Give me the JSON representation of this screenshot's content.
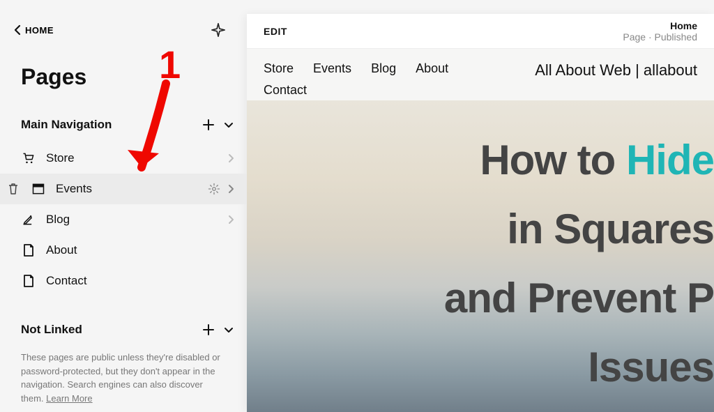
{
  "sidebar": {
    "back_label": "HOME",
    "title": "Pages",
    "main_nav": {
      "title": "Main Navigation",
      "items": [
        {
          "label": "Store"
        },
        {
          "label": "Events"
        },
        {
          "label": "Blog"
        },
        {
          "label": "About"
        },
        {
          "label": "Contact"
        }
      ]
    },
    "not_linked": {
      "title": "Not Linked",
      "desc_prefix": "These pages are public unless they're disabled or password-protected, but they don't appear in the navigation. Search engines can also discover them. ",
      "learn_more": "Learn More"
    }
  },
  "preview": {
    "edit_label": "EDIT",
    "page_name": "Home",
    "page_meta": "Page · Published",
    "site_nav": [
      "Store",
      "Events",
      "Blog",
      "About",
      "Contact"
    ],
    "site_title": "All About Web | allabout",
    "hero_line1_a": "How to ",
    "hero_line1_b": "Hide",
    "hero_line2": "in Squares",
    "hero_line3": "and Prevent P",
    "hero_line4": "Issues"
  },
  "annotation": {
    "number": "1"
  }
}
